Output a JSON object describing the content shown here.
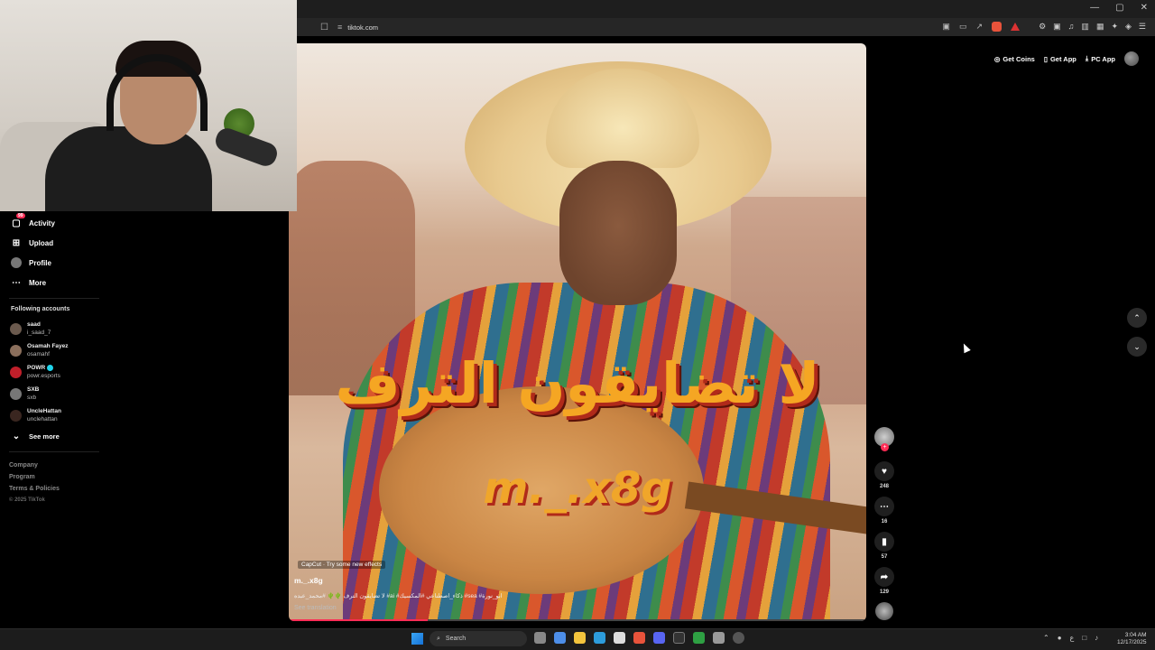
{
  "browser": {
    "url": "tiktok.com",
    "window_controls": [
      "—",
      "▢",
      "✕"
    ]
  },
  "topbar": {
    "get_coins": "Get Coins",
    "get_app": "Get App",
    "pc_app": "PC App"
  },
  "sidebar": {
    "items": [
      {
        "label": "Activity",
        "badge": "99"
      },
      {
        "label": "Upload"
      },
      {
        "label": "Profile"
      },
      {
        "label": "More"
      }
    ],
    "following_title": "Following accounts",
    "accounts": [
      {
        "name": "saad",
        "handle": "i_saad_7",
        "color": "#6b5a4e"
      },
      {
        "name": "Osamah Fayez",
        "handle": "osamahf",
        "color": "#8b6f5c"
      },
      {
        "name": "POWR",
        "handle": "powr.esports",
        "color": "#c01f2a"
      },
      {
        "name": "SXB",
        "handle": "sxb",
        "color": "#777777"
      },
      {
        "name": "UncleHattan",
        "handle": "unclehattan",
        "color": "#3a2620"
      }
    ],
    "see_more": "See more",
    "footer": [
      "Company",
      "Program",
      "Terms & Policies",
      "© 2025 TikTok"
    ]
  },
  "video": {
    "overlay_text": "لا تضايقون الترف",
    "watermark": "m._.x8g",
    "capcut": "CapCut · Try some new effects",
    "username": "m._.x8g",
    "caption": "لا تضايقون الترف 🌵🌵 #محمد_عبده #ai #ذكاء_اصطناعي #المكسيك #sea #ابو_نورة",
    "see_translation": "See translation",
    "progress": 0.24
  },
  "actions": {
    "likes": "248",
    "comments": "16",
    "saves": "57",
    "shares": "129"
  },
  "taskbar": {
    "search_placeholder": "Search",
    "time": "3:04 AM",
    "date": "12/17/2025"
  }
}
